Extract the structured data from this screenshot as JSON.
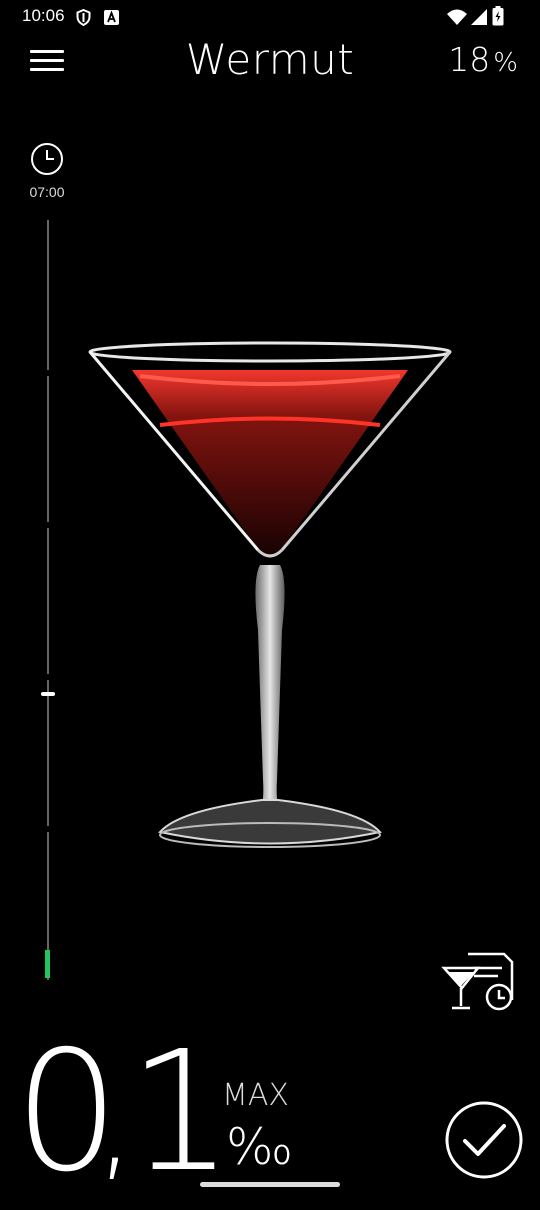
{
  "status_bar": {
    "time": "10:06",
    "icons": [
      "shield-icon",
      "font-a-icon",
      "wifi-icon",
      "signal-icon",
      "battery-icon"
    ]
  },
  "header": {
    "title": "Wermut",
    "abv_value": "18",
    "abv_unit": "%",
    "menu_icon": "hamburger-menu-icon"
  },
  "timeline": {
    "start_time": "07:00",
    "clock_icon": "clock-icon",
    "accent_color": "#22c55e"
  },
  "drink": {
    "image": "martini-glass-with-red-vermouth",
    "liquid_color": "#d4302b"
  },
  "history_button": {
    "icon": "drink-history-icon"
  },
  "reading": {
    "integer": "0",
    "separator": ",",
    "decimal": "1",
    "max_label": "MAX",
    "unit": "‰"
  },
  "confirm_button": {
    "icon": "checkmark-icon"
  }
}
